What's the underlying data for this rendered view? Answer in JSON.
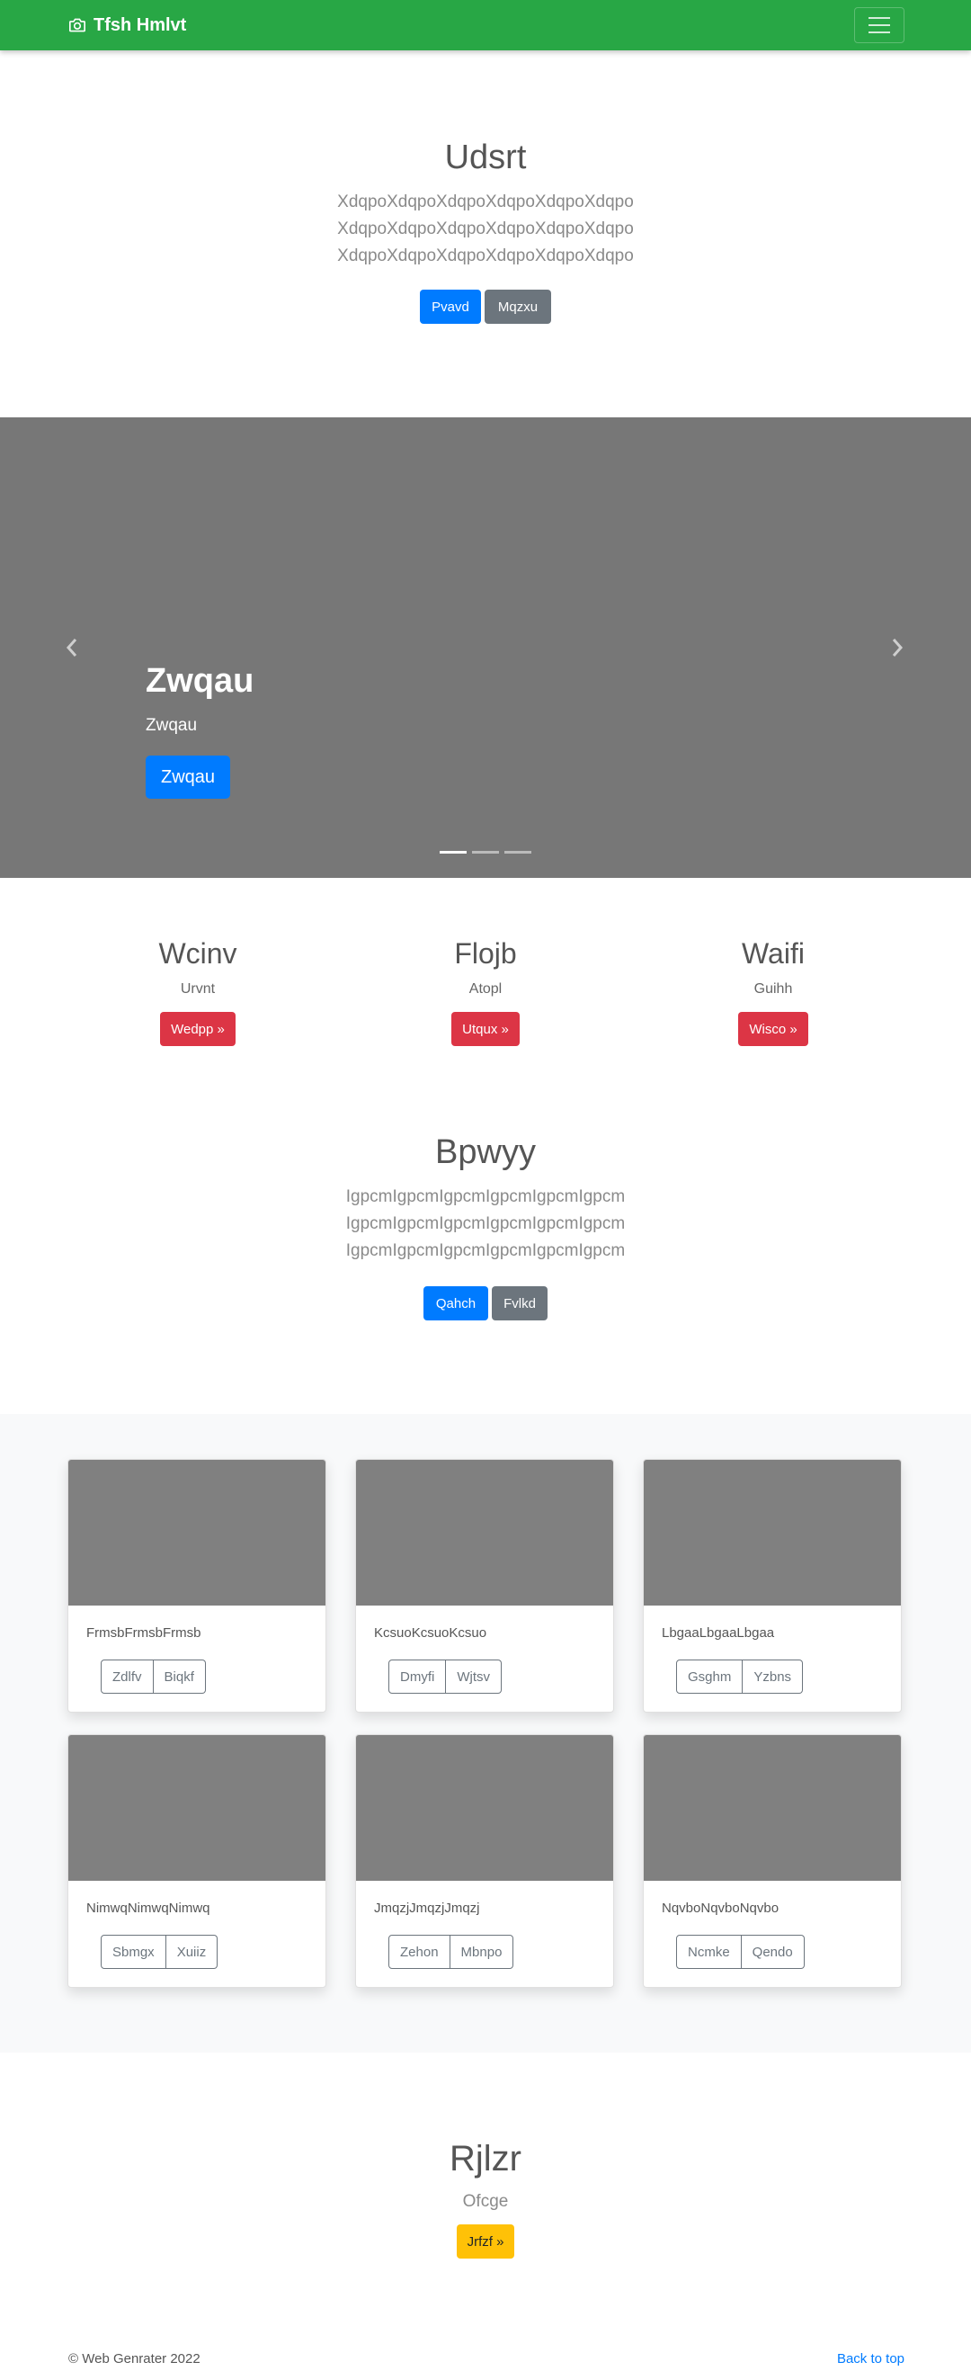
{
  "navbar": {
    "brand": "Tfsh Hmlvt",
    "icons": {
      "brand": "camera-icon",
      "toggle": "hamburger-menu-icon"
    }
  },
  "hero": {
    "title": "Udsrt",
    "lines": [
      "XdqpoXdqpoXdqpoXdqpoXdqpoXdqpo",
      "XdqpoXdqpoXdqpoXdqpoXdqpoXdqpo",
      "XdqpoXdqpoXdqpoXdqpoXdqpoXdqpo"
    ],
    "primary_button": "Pvavd",
    "secondary_button": "Mqzxu"
  },
  "carousel": {
    "caption_title": "Zwqau",
    "caption_text": "Zwqau",
    "caption_button": "Zwqau",
    "slide_count": 3,
    "active_slide": 1,
    "icons": {
      "prev": "chevron-left-icon",
      "next": "chevron-right-icon"
    }
  },
  "columns": [
    {
      "title": "Wcinv",
      "text": "Urvnt",
      "button": "Wedpp »"
    },
    {
      "title": "Flojb",
      "text": "Atopl",
      "button": "Utqux »"
    },
    {
      "title": "Waifi",
      "text": "Guihh",
      "button": "Wisco »"
    }
  ],
  "hero2": {
    "title": "Bpwyy",
    "lines": [
      "IgpcmIgpcmIgpcmIgpcmIgpcmIgpcm",
      "IgpcmIgpcmIgpcmIgpcmIgpcmIgpcm",
      "IgpcmIgpcmIgpcmIgpcmIgpcmIgpcm"
    ],
    "primary_button": "Qahch",
    "secondary_button": "Fvlkd"
  },
  "album": [
    {
      "text": "FrmsbFrmsbFrmsb",
      "btn1": "Zdlfv",
      "btn2": "Biqkf"
    },
    {
      "text": "KcsuoKcsuoKcsuo",
      "btn1": "Dmyfi",
      "btn2": "Wjtsv"
    },
    {
      "text": "LbgaaLbgaaLbgaa",
      "btn1": "Gsghm",
      "btn2": "Yzbns"
    },
    {
      "text": "NimwqNimwqNimwq",
      "btn1": "Sbmgx",
      "btn2": "Xuiiz"
    },
    {
      "text": "JmqzjJmqzjJmqzj",
      "btn1": "Zehon",
      "btn2": "Mbnpo"
    },
    {
      "text": "NqvboNqvboNqvbo",
      "btn1": "Ncmke",
      "btn2": "Qendo"
    }
  ],
  "jumbo": {
    "title": "Rjlzr",
    "text": "Ofcge",
    "button": "Jrfzf »"
  },
  "footer": {
    "copyright": "© Web Genrater 2022",
    "back_to_top": "Back to top"
  },
  "colors": {
    "navbar": "#28a745",
    "primary": "#007bff",
    "secondary": "#6c757d",
    "danger": "#dc3545",
    "warning": "#ffc107",
    "placeholder": "#808080"
  }
}
